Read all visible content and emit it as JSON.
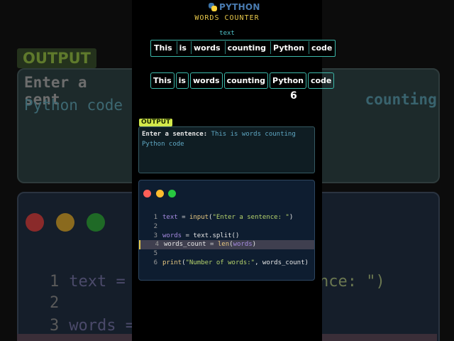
{
  "header": {
    "logo_text": "PYTHON",
    "subtitle": "WORDS COUNTER"
  },
  "visual": {
    "variable_label": "text",
    "words": [
      "This",
      "is",
      "words",
      "counting",
      "Python",
      "code"
    ],
    "count": "6"
  },
  "output": {
    "tag": "OUTPUT",
    "prompt": "Enter a sentence:",
    "input_line1": "This is words counting",
    "input_line2": "Python code"
  },
  "code": {
    "active_line": 4,
    "lines": [
      {
        "num": "1",
        "tokens": [
          {
            "t": "text",
            "c": "var"
          },
          {
            "t": " = ",
            "c": "op"
          },
          {
            "t": "input",
            "c": "fn"
          },
          {
            "t": "(",
            "c": "plain"
          },
          {
            "t": "\"Enter a sentence: \"",
            "c": "str"
          },
          {
            "t": ")",
            "c": "plain"
          }
        ]
      },
      {
        "num": "2",
        "tokens": []
      },
      {
        "num": "3",
        "tokens": [
          {
            "t": "words",
            "c": "var"
          },
          {
            "t": " = ",
            "c": "op"
          },
          {
            "t": "text.split()",
            "c": "plain"
          }
        ]
      },
      {
        "num": "4",
        "tokens": [
          {
            "t": "words_count",
            "c": "plain"
          },
          {
            "t": " = ",
            "c": "op"
          },
          {
            "t": "len",
            "c": "fn"
          },
          {
            "t": "(",
            "c": "plain"
          },
          {
            "t": "words",
            "c": "var"
          },
          {
            "t": ")",
            "c": "plain"
          }
        ]
      },
      {
        "num": "5",
        "tokens": []
      },
      {
        "num": "6",
        "tokens": [
          {
            "t": "print",
            "c": "fn"
          },
          {
            "t": "(",
            "c": "plain"
          },
          {
            "t": "\"Number of words:\"",
            "c": "str"
          },
          {
            "t": ", words_count)",
            "c": "plain"
          }
        ]
      }
    ]
  },
  "background": {
    "output_tag": "OUTPUT",
    "output_line1_prompt": "Enter a sent",
    "output_line1_value": "counting",
    "output_line2": "Python code",
    "code_line_numbers": [
      "1",
      "2",
      "3"
    ],
    "code_line1_var": "text =",
    "code_line1_tail": "nce: \")",
    "code_line3_var": "words ="
  },
  "colors": {
    "accent_yellow": "#e7c84a",
    "token_border": "#3cb7a9",
    "output_tag_bg": "#d3e94b",
    "traffic_red": "#ff5f57",
    "traffic_yellow": "#febc2e",
    "traffic_green": "#28c840"
  }
}
